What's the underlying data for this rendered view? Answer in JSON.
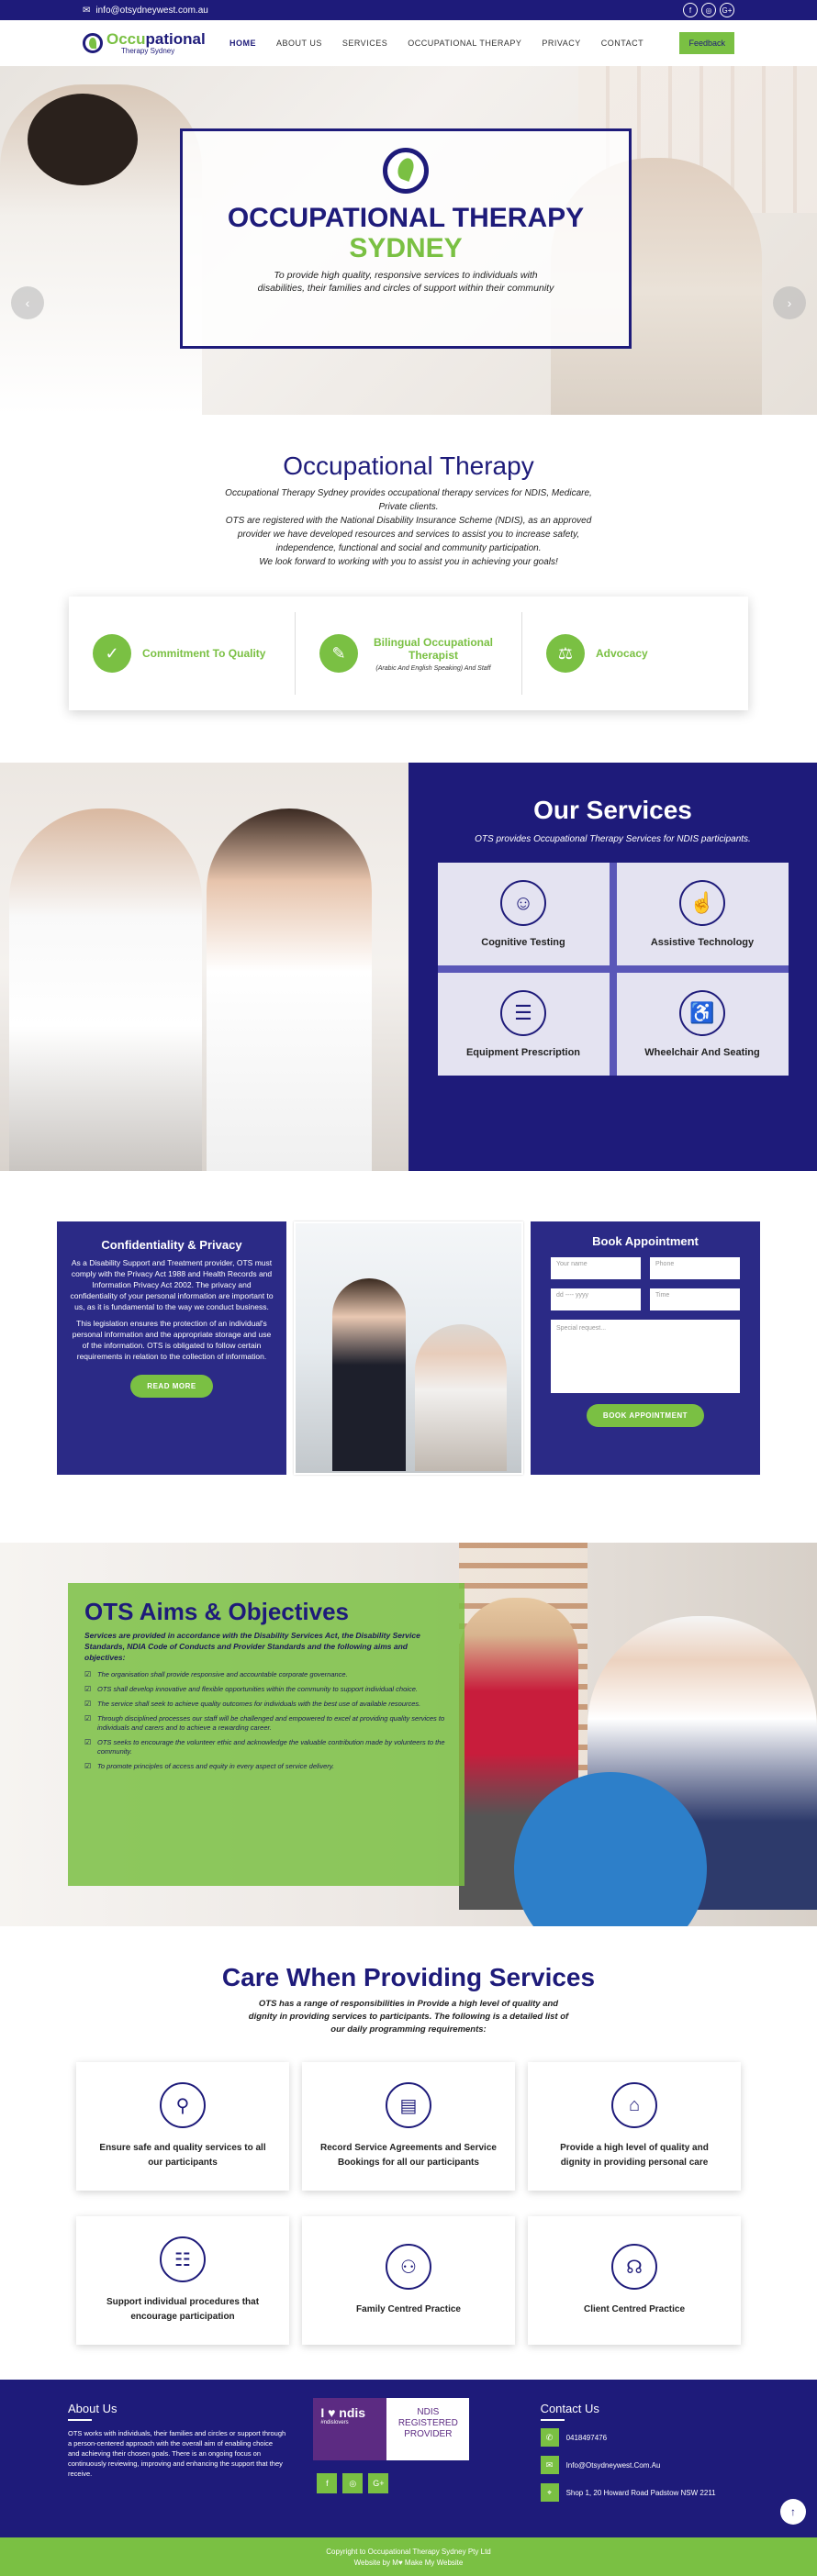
{
  "topbar": {
    "email": "info@otsydneywest.com.au",
    "email_icon": "envelope-icon",
    "socials": [
      "f",
      "◎",
      "G+"
    ]
  },
  "header": {
    "logo_line1_a": "Occu",
    "logo_line1_b": "pational",
    "logo_line2": "Therapy Sydney",
    "nav": [
      "HOME",
      "ABOUT US",
      "SERVICES",
      "OCCUPATIONAL THERAPY",
      "PRIVACY",
      "CONTACT"
    ],
    "feedback": "Feedback"
  },
  "hero": {
    "title": "OCCUPATIONAL THERAPY",
    "subtitle": "SYDNEY",
    "text": "To provide high quality, responsive services to individuals with disabilities, their families and circles of support within their community",
    "prev": "‹",
    "next": "›"
  },
  "intro": {
    "heading": "Occupational Therapy",
    "p1": "Occupational Therapy Sydney provides occupational therapy services for NDIS, Medicare, Private clients.",
    "p2": "OTS are registered with the National Disability Insurance Scheme (NDIS), as an approved provider we have developed resources and services to assist you to increase safety, independence, functional and social and community participation.",
    "p3": "We look forward to working with you to assist you in achieving your goals!"
  },
  "features": [
    {
      "title": "Commitment To Quality",
      "sub": "",
      "icon": "✓"
    },
    {
      "title": "Bilingual Occupational Therapist",
      "sub": "(Arabic And English Speaking) And Staff",
      "icon": "✎"
    },
    {
      "title": "Advocacy",
      "sub": "",
      "icon": "⚖"
    }
  ],
  "services": {
    "heading": "Our Services",
    "sub": "OTS provides Occupational Therapy Services for NDIS participants.",
    "items": [
      {
        "label": "Cognitive Testing",
        "icon": "☺"
      },
      {
        "label": "Assistive Technology",
        "icon": "☝"
      },
      {
        "label": "Equipment Prescription",
        "icon": "☰"
      },
      {
        "label": "Wheelchair And Seating",
        "icon": "♿"
      }
    ]
  },
  "privacy": {
    "heading": "Confidentiality & Privacy",
    "p1": "As a Disability Support and Treatment provider, OTS must comply with the Privacy Act 1988 and Health Records and Information Privacy Act 2002. The privacy and confidentiality of your personal information are important to us, as it is fundamental to the way we conduct business.",
    "p2": "This legislation ensures the protection of an individual's personal information and the appropriate storage and use of the information. OTS is obligated to follow certain requirements in relation to the collection of information.",
    "button": "READ MORE"
  },
  "booking": {
    "heading": "Book Appointment",
    "name": "Your name",
    "phone": "Phone",
    "date": "dd ---- yyyy",
    "time": "Time",
    "special": "Special request...",
    "button": "BOOK APPOINTMENT"
  },
  "aims": {
    "heading": "OTS Aims & Objectives",
    "lead": "Services are provided in accordance with the Disability Services Act, the Disability Service Standards, NDIA Code of Conducts and Provider Standards and the following aims and objectives:",
    "items": [
      "The organisation shall provide responsive and accountable corporate governance.",
      "OTS shall develop innovative and flexible opportunities within the community to support individual choice.",
      "The service shall seek to achieve quality outcomes for individuals with the best use of available resources.",
      "Through disciplined processes our staff will be challenged and empowered to excel at providing quality services to individuals and carers and to achieve a rewarding career.",
      "OTS seeks to encourage the volunteer ethic and acknowledge the valuable contribution made by volunteers to the community.",
      "To promote principles of access and equity in every aspect of service delivery."
    ]
  },
  "care": {
    "heading": "Care When Providing Services",
    "sub": "OTS has a range of responsibilities in Provide a high level of quality and dignity in providing services to participants. The following is a detailed list of our daily programming requirements:",
    "items": [
      {
        "label": "Ensure safe and quality services to all our participants",
        "icon": "⚲"
      },
      {
        "label": "Record Service Agreements and Service Bookings for all our participants",
        "icon": "▤"
      },
      {
        "label": "Provide a high level of quality and dignity in providing personal care",
        "icon": "⌂"
      },
      {
        "label": "Support individual procedures that encourage participation",
        "icon": "☷"
      },
      {
        "label": "Family Centred Practice",
        "icon": "⚇"
      },
      {
        "label": "Client Centred Practice",
        "icon": "☊"
      }
    ]
  },
  "footer": {
    "about_heading": "About Us",
    "about_text": "OTS works with individuals, their families and circles or support through a person-centered approach with the overall aim of enabling choice and achieving their chosen goals. There is an ongoing focus on continuously reviewing, improving and enhancing the support that they receive.",
    "ndis_left": "I ♥ ndis",
    "ndis_left_small": "#ndislovers",
    "ndis_right": "NDIS REGISTERED PROVIDER",
    "contact_heading": "Contact Us",
    "phone": "0418497476",
    "email": "Info@Otsydneywest.Com.Au",
    "address": "Shop 1, 20 Howard Road Padstow NSW 2211",
    "copyright": "Copyright to Occupational Therapy Sydney Pty Ltd",
    "credit": "Website by M♥ Make My Website",
    "totop": "↑"
  },
  "colors": {
    "navy": "#1e1b7a",
    "green": "#7ac043"
  }
}
